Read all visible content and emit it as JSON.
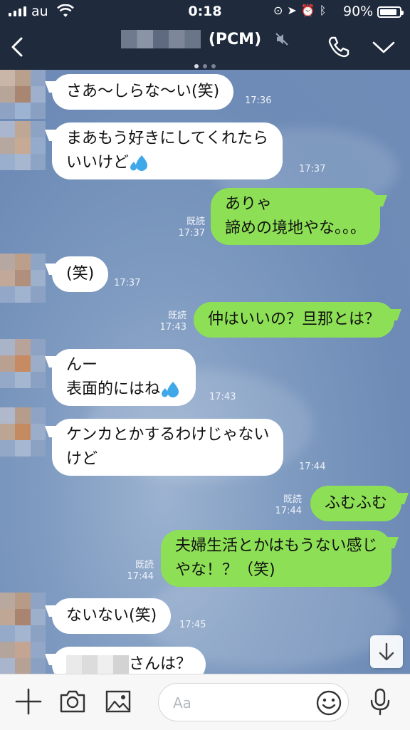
{
  "status_bar": {
    "carrier": "au",
    "time": "0:18",
    "battery": "90%",
    "battery_level": 0.9
  },
  "header": {
    "title": "(PCM)",
    "page_dots": 3,
    "active_dot": 0
  },
  "messages": [
    {
      "side": "in",
      "lines": [
        "さあ〜しらな〜い(笑)"
      ],
      "time": "17:36"
    },
    {
      "side": "in",
      "lines": [
        "まあもう好きにしてくれたら",
        "いいけど"
      ],
      "emoji": "sweat-drops-icon",
      "time": "17:37"
    },
    {
      "side": "out",
      "lines": [
        "ありゃ",
        "諦めの境地やな。。。"
      ],
      "read": "既読",
      "time": "17:37"
    },
    {
      "side": "in",
      "lines": [
        "(笑)"
      ],
      "time": "17:37"
    },
    {
      "side": "out",
      "lines": [
        "仲はいいの？旦那とは？"
      ],
      "read": "既読",
      "time": "17:43"
    },
    {
      "side": "in",
      "lines": [
        "んー",
        "表面的にはね"
      ],
      "emoji": "sweat-drops-icon",
      "time": "17:43"
    },
    {
      "side": "in",
      "lines": [
        "ケンカとかするわけじゃない",
        "けど"
      ],
      "time": "17:44"
    },
    {
      "side": "out",
      "lines": [
        "ふむふむ"
      ],
      "read": "既読",
      "time": "17:44"
    },
    {
      "side": "out",
      "lines": [
        "夫婦生活とかはもうない感じ",
        "やな！？（笑)"
      ],
      "read": "既読",
      "time": "17:44"
    },
    {
      "side": "in",
      "lines": [
        "ないない(笑)"
      ],
      "time": "17:45"
    },
    {
      "side": "in",
      "lines": [
        "さんは？"
      ],
      "time": ""
    }
  ],
  "input": {
    "placeholder": "Aa"
  },
  "icons": {
    "back": "chevron-left-icon",
    "mute": "mute-icon",
    "call": "phone-icon",
    "menu": "chevron-down-icon",
    "add": "plus-icon",
    "camera": "camera-icon",
    "image": "image-icon",
    "emoji": "smiley-icon",
    "mic": "microphone-icon",
    "scroll": "arrow-down-icon"
  },
  "colors": {
    "header_bg": "#1f2a3d",
    "incoming_bubble": "#ffffff",
    "outgoing_bubble": "#8de055",
    "chat_bg": "#7f9bc1"
  }
}
